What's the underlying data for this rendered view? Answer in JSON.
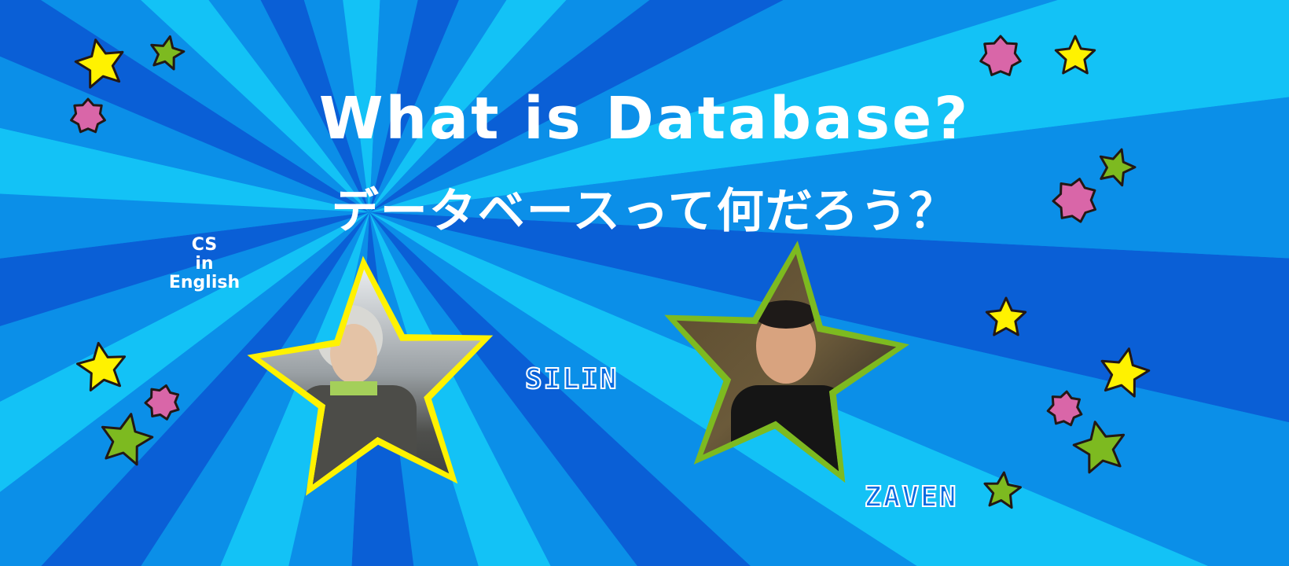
{
  "banner": {
    "title": "What is Database?",
    "subtitle": "データベースって何だろう？",
    "series_label": [
      "CS",
      "in",
      "English"
    ],
    "people": [
      {
        "name": "SILIN",
        "frame_color": "#fff200"
      },
      {
        "name": "ZAVEN",
        "frame_color": "#7dba20"
      }
    ]
  },
  "colors": {
    "ray_dark": "#0a5fd6",
    "ray_mid": "#0b8fe8",
    "ray_light": "#13c2f6",
    "star_yellow": "#fff200",
    "star_green": "#7dba20",
    "star_pink": "#d966a8"
  }
}
